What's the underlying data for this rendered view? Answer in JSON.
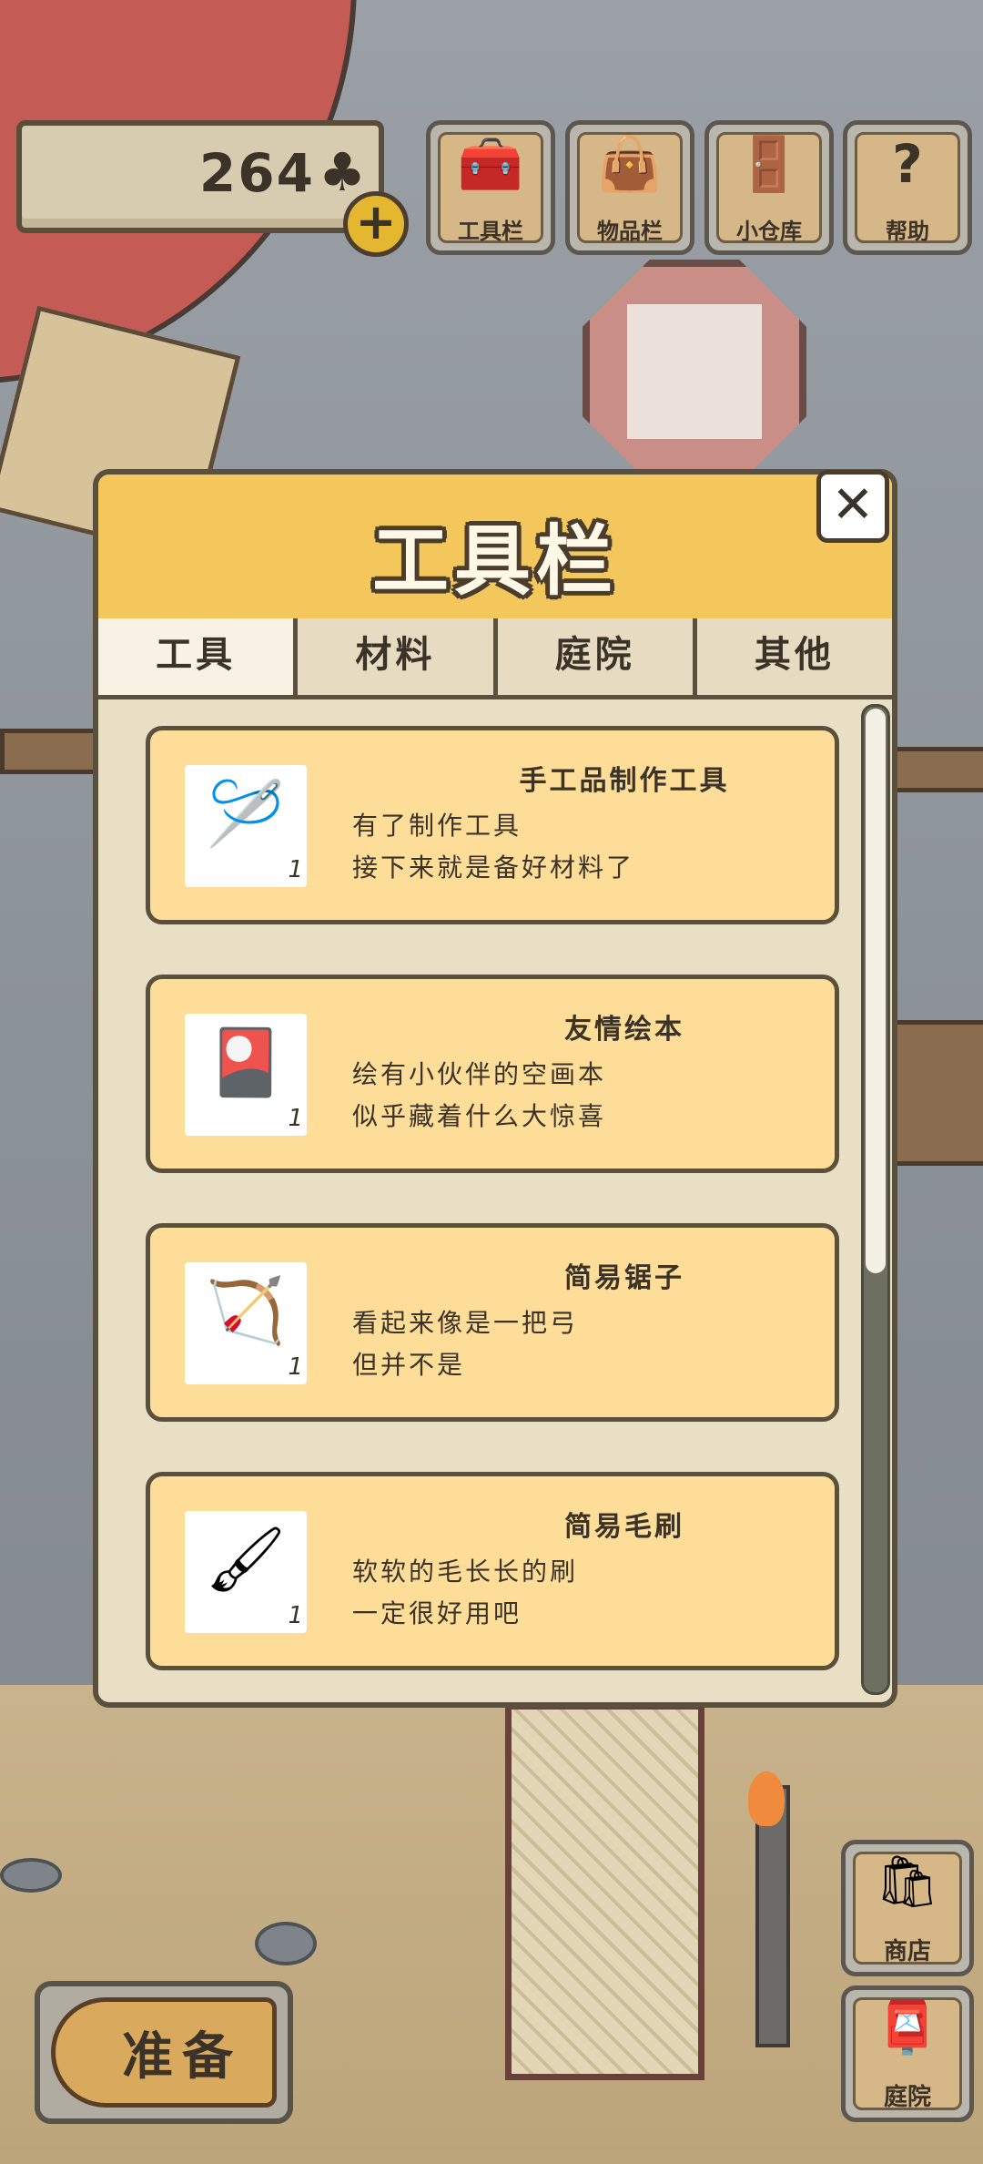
{
  "currency": {
    "value": "264",
    "icon": "clover-icon"
  },
  "hud_buttons": [
    {
      "label": "工具栏",
      "icon": "toolbox-icon"
    },
    {
      "label": "物品栏",
      "icon": "bag-icon"
    },
    {
      "label": "小仓库",
      "icon": "door-icon"
    },
    {
      "label": "帮助",
      "icon": "question-icon"
    }
  ],
  "panel": {
    "title": "工具栏",
    "tabs": [
      "工具",
      "材料",
      "庭院",
      "其他"
    ],
    "active_tab": "工具",
    "items": [
      {
        "name": "手工品制作工具",
        "desc_line1": "有了制作工具",
        "desc_line2": "接下来就是备好材料了",
        "qty": "1",
        "icon": "craft-tools-icon"
      },
      {
        "name": "友情绘本",
        "desc_line1": "绘有小伙伴的空画本",
        "desc_line2": "似乎藏着什么大惊喜",
        "qty": "1",
        "icon": "picture-book-icon"
      },
      {
        "name": "简易锯子",
        "desc_line1": "看起来像是一把弓",
        "desc_line2": "但并不是",
        "qty": "1",
        "icon": "saw-icon"
      },
      {
        "name": "简易毛刷",
        "desc_line1": "软软的毛长长的刷",
        "desc_line2": "一定很好用吧",
        "qty": "1",
        "icon": "brush-icon"
      }
    ]
  },
  "bottom": {
    "ready_label": "准备",
    "shop_label": "商店",
    "yard_label": "庭院"
  },
  "colors": {
    "panel_header": "#f4c75c",
    "item_bg": "#fedd98",
    "border": "#5a503e"
  }
}
